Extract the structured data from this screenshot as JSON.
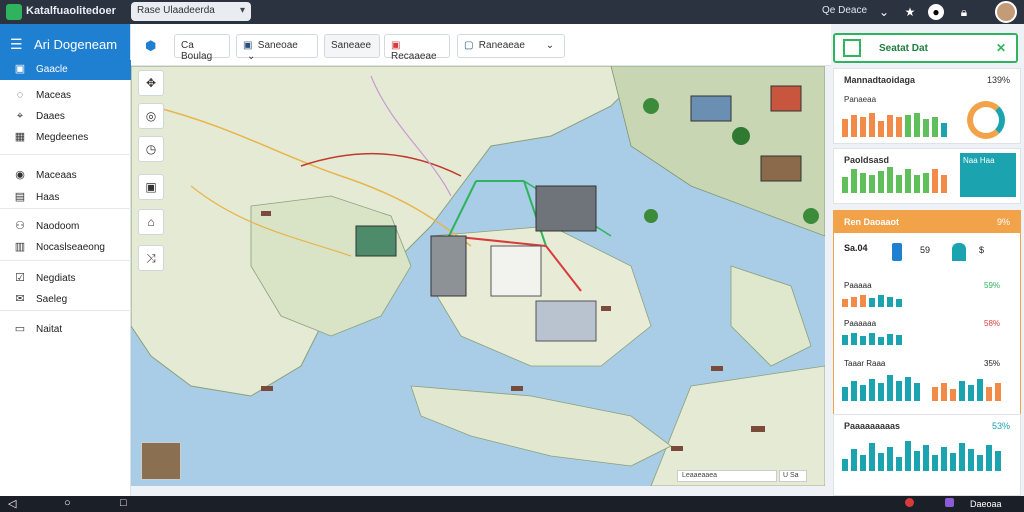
{
  "topbar": {
    "app_name": "Katalfuaolitedoer",
    "pill_label": "Rase Ulaadeerda",
    "user_label": "Qe Deace",
    "icons": [
      "star-icon",
      "bell-icon",
      "lock-icon"
    ]
  },
  "sidebar": {
    "title": "Ari Dogeneam",
    "items": [
      {
        "label": "Gaacle",
        "icon": "calendar-icon",
        "active": true
      },
      {
        "label": "Maceas",
        "icon": "map-icon"
      },
      {
        "label": "Daaes",
        "icon": "pin-icon"
      },
      {
        "label": "Megdeenes",
        "icon": "grid-icon"
      },
      {
        "label": "Maceaas",
        "icon": "location-icon"
      },
      {
        "label": "Haas",
        "icon": "table-icon"
      },
      {
        "label": "Naodoom",
        "icon": "people-icon"
      },
      {
        "label": "Nocaslseaeong",
        "icon": "chart-icon"
      },
      {
        "label": "Negdiats",
        "icon": "check-icon"
      },
      {
        "label": "Saeleg",
        "icon": "mail-icon"
      },
      {
        "label": "Naitat",
        "icon": "document-icon"
      }
    ]
  },
  "toolbar": {
    "buttons": [
      {
        "label": "Ca Boulag",
        "icon": "search-icon"
      },
      {
        "label": "Saneoae",
        "icon": "doc-icon"
      },
      {
        "label": "Saneaee",
        "icon": "filter-icon"
      },
      {
        "label": "Recaaeae",
        "icon": "flag-icon"
      },
      {
        "label": "Raneaeae",
        "icon": "layers-icon"
      }
    ]
  },
  "map": {
    "footer_label": "Leaaeaaea",
    "attribution": "U Sa"
  },
  "rpanel": {
    "header_title": "Seatat Dat",
    "cards": [
      {
        "title": "Mannadtaoidaga",
        "value": "139%"
      },
      {
        "title": "Panaeaa",
        "value": ""
      },
      {
        "title": "Paoldsasd",
        "value": "Naa Haa"
      },
      {
        "title": "Ren Daoaaot",
        "value": "9%",
        "accent": "#f2a34a"
      },
      {
        "title": "Sa.04",
        "value": "59"
      },
      {
        "title": "Paaaaa",
        "value": "59%"
      },
      {
        "title": "Paaaaaa",
        "value": "58%"
      },
      {
        "title": "Taaar Raaa",
        "value": "35%"
      },
      {
        "title": "Paaaaaaaaas",
        "value": "53%"
      }
    ]
  },
  "taskbar": {
    "time": "Daeoaa"
  },
  "colors": {
    "brand": "#1f7fd1",
    "accent_green": "#2fb35c",
    "accent_orange": "#f2a34a",
    "teal": "#1ba3b0"
  }
}
